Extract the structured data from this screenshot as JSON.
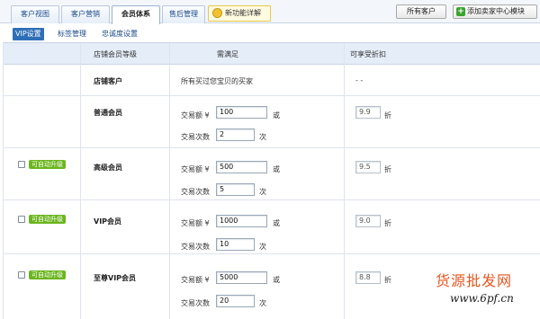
{
  "tabs": [
    {
      "label": "客户视图",
      "active": false
    },
    {
      "label": "客户营销",
      "active": false
    },
    {
      "label": "会员体系",
      "active": true
    },
    {
      "label": "售后管理",
      "active": false
    }
  ],
  "feature_link": "新功能详解",
  "buttons": {
    "all_customers": "所有客户",
    "add_module": "添加卖家中心模块"
  },
  "subnav": [
    {
      "label": "VIP设置",
      "active": true
    },
    {
      "label": "标签管理",
      "active": false
    },
    {
      "label": "忠诚度设置",
      "active": false
    }
  ],
  "table": {
    "headers": {
      "level": "店铺会员等级",
      "condition": "需满足",
      "discount": "可享受折扣"
    },
    "store_customer": {
      "name": "店铺客户",
      "condition": "所有买过您宝贝的买家",
      "discount": "- -"
    },
    "labels": {
      "amount": "交易额 ¥",
      "or": "或",
      "count": "交易次数",
      "times": "次",
      "discount_unit": "折"
    },
    "auto_upgrade": "可自动升级",
    "levels": [
      {
        "name": "普通会员",
        "amount": "100",
        "count": "2",
        "discount": "9.9",
        "has_checkbox": false
      },
      {
        "name": "高级会员",
        "amount": "500",
        "count": "5",
        "discount": "9.5",
        "has_checkbox": true
      },
      {
        "name": "VIP会员",
        "amount": "1000",
        "count": "10",
        "discount": "9.0",
        "has_checkbox": true
      },
      {
        "name": "至尊VIP会员",
        "amount": "5000",
        "count": "20",
        "discount": "8.8",
        "has_checkbox": true
      }
    ]
  },
  "watermark": {
    "line1": "货源批发网",
    "line2": "www.6pf.cn"
  },
  "colors": {
    "accent": "#2f6fb8",
    "badge": "#6bb51e",
    "header_bg": "#e5edf8"
  }
}
